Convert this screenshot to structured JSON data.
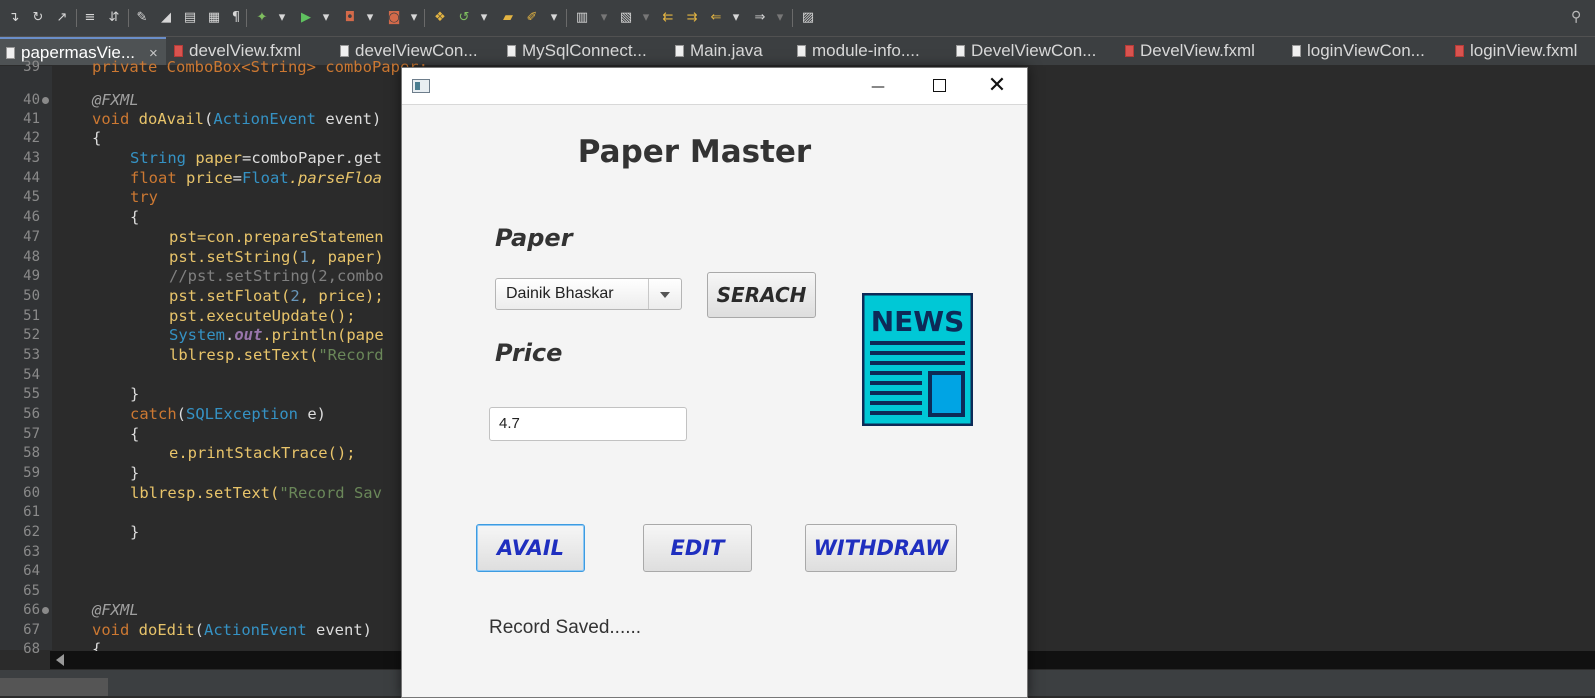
{
  "ide": {
    "tabs": [
      {
        "label": "papermasVie...",
        "active": true,
        "kind": "java",
        "closable": true
      },
      {
        "label": "develView.fxml",
        "kind": "fxml"
      },
      {
        "label": "develViewCon...",
        "kind": "java"
      },
      {
        "label": "MySqlConnect...",
        "kind": "java"
      },
      {
        "label": "Main.java",
        "kind": "java"
      },
      {
        "label": "module-info....",
        "kind": "java"
      },
      {
        "label": "DevelViewCon...",
        "kind": "java"
      },
      {
        "label": "DevelView.fxml",
        "kind": "fxml"
      },
      {
        "label": "loginViewCon...",
        "kind": "java"
      },
      {
        "label": "loginView.fxml",
        "kind": "fxml"
      }
    ],
    "close_glyph": "×",
    "line_numbers": [
      "39",
      "40",
      "41",
      "42",
      "43",
      "44",
      "45",
      "46",
      "47",
      "48",
      "49",
      "50",
      "51",
      "52",
      "53",
      "54",
      "55",
      "56",
      "57",
      "58",
      "59",
      "60",
      "61",
      "62",
      "63",
      "64",
      "65",
      "66",
      "67",
      "68"
    ],
    "code": {
      "l39": "private ComboBox<String> comboPaper;",
      "l40": "@FXML",
      "l41_void": "void ",
      "l41_name": "doAvail",
      "l41_type": "ActionEvent",
      "l41_rest": " event)",
      "l42": "{",
      "l43_type": "String ",
      "l43_var": "paper",
      "l43_rest": "=comboPaper.get",
      "l44_kw": "float ",
      "l44_var": "price",
      "l44_eq": "=",
      "l44_type": "Float",
      "l44_m": ".parseFloa",
      "l45": "try",
      "l46": "{",
      "l47": "pst=con.prepareStatemen",
      "l48_a": "pst.setString(",
      "l48_n": "1",
      "l48_b": ", paper)",
      "l49": "//pst.setString(2,combo",
      "l50_a": "pst.setFloat(",
      "l50_n": "2",
      "l50_b": ", price);",
      "l51": "pst.executeUpdate();",
      "l52_a": "System",
      "l52_b": ".",
      "l52_c": "out",
      "l52_d": ".println(pape",
      "l53_a": "lblresp.setText(",
      "l53_s": "\"Record",
      "l55": "}",
      "l56_kw": "catch",
      "l56_p": "(",
      "l56_t": "SQLException",
      "l56_r": " e)",
      "l57": "{",
      "l58": "e.printStackTrace();",
      "l59": "}",
      "l60_a": "lblresp.setText(",
      "l60_s": "\"Record Sav",
      "l62": "}",
      "l66": "@FXML",
      "l67_void": "void ",
      "l67_name": "doEdit",
      "l67_type": "ActionEvent",
      "l67_rest": " event)",
      "l68": "{"
    }
  },
  "window": {
    "title": "",
    "minimize_glyph": "—",
    "close_glyph": "✕"
  },
  "form": {
    "heading": "Paper Master",
    "paper_label": "Paper",
    "paper_selected": "Dainik Bhaskar",
    "search_button": "SERACH",
    "price_label": "Price",
    "price_value": "4.7",
    "image_text": "NEWS",
    "avail_button": "AVAIL",
    "edit_button": "EDIT",
    "withdraw_button": "WITHDRAW",
    "response": "Record Saved......"
  },
  "colors": {
    "button_text": "#1f2fbf",
    "news_fill": "#00c8d6",
    "news_dark": "#0d2a57"
  },
  "icons": [
    "step-over-icon",
    "step-back-icon",
    "run-to-cursor-icon",
    "toggle-comment-icon",
    "format-icon",
    "bookmark-icon",
    "run-icon",
    "debug-icon",
    "profile-icon",
    "search-icon"
  ]
}
